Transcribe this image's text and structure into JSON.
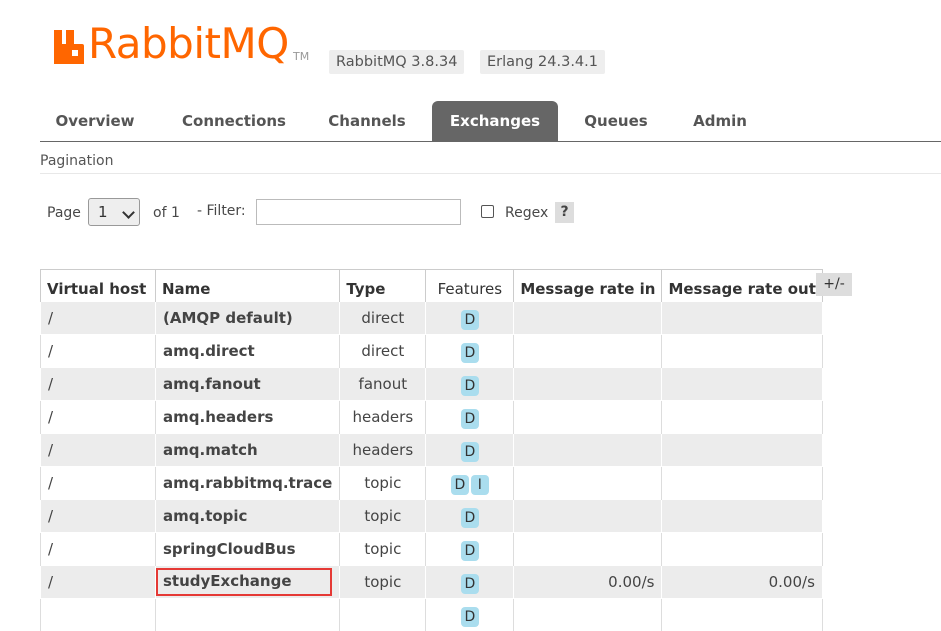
{
  "logo": {
    "text": "RabbitMQ",
    "tm": "TM",
    "color": "#ff6600"
  },
  "versions": [
    "RabbitMQ 3.8.34",
    "Erlang 24.3.4.1"
  ],
  "tabs": [
    "Overview",
    "Connections",
    "Channels",
    "Exchanges",
    "Queues",
    "Admin"
  ],
  "active_tab": "Exchanges",
  "section": "Pagination",
  "pager": {
    "page_label": "Page",
    "page_value": "1",
    "of_label": "of 1",
    "filter_label": "- Filter:",
    "filter_value": "",
    "regex_label": "Regex",
    "regex_checked": false,
    "help": "?"
  },
  "table": {
    "columns": [
      "Virtual host",
      "Name",
      "Type",
      "Features",
      "Message rate in",
      "Message rate out"
    ],
    "toggle": "+/-",
    "rows": [
      {
        "vhost": "/",
        "name": "(AMQP default)",
        "type": "direct",
        "features": [
          "D"
        ],
        "rate_in": "",
        "rate_out": ""
      },
      {
        "vhost": "/",
        "name": "amq.direct",
        "type": "direct",
        "features": [
          "D"
        ],
        "rate_in": "",
        "rate_out": ""
      },
      {
        "vhost": "/",
        "name": "amq.fanout",
        "type": "fanout",
        "features": [
          "D"
        ],
        "rate_in": "",
        "rate_out": ""
      },
      {
        "vhost": "/",
        "name": "amq.headers",
        "type": "headers",
        "features": [
          "D"
        ],
        "rate_in": "",
        "rate_out": ""
      },
      {
        "vhost": "/",
        "name": "amq.match",
        "type": "headers",
        "features": [
          "D"
        ],
        "rate_in": "",
        "rate_out": ""
      },
      {
        "vhost": "/",
        "name": "amq.rabbitmq.trace",
        "type": "topic",
        "features": [
          "D",
          "I"
        ],
        "rate_in": "",
        "rate_out": ""
      },
      {
        "vhost": "/",
        "name": "amq.topic",
        "type": "topic",
        "features": [
          "D"
        ],
        "rate_in": "",
        "rate_out": ""
      },
      {
        "vhost": "/",
        "name": "springCloudBus",
        "type": "topic",
        "features": [
          "D"
        ],
        "rate_in": "",
        "rate_out": ""
      },
      {
        "vhost": "/",
        "name": "studyExchange",
        "type": "topic",
        "features": [
          "D"
        ],
        "rate_in": "0.00/s",
        "rate_out": "0.00/s",
        "highlighted": true
      },
      {
        "vhost": "",
        "name": "",
        "type": "",
        "features": [
          "D"
        ],
        "rate_in": "",
        "rate_out": ""
      }
    ]
  }
}
